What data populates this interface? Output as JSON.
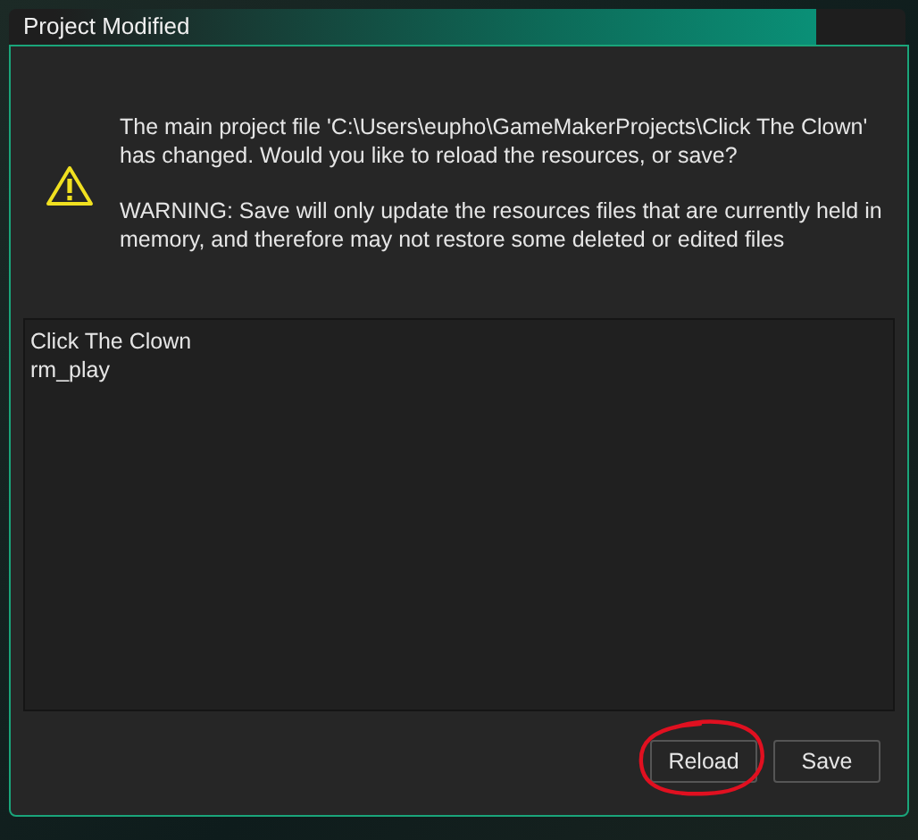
{
  "window": {
    "title": "Project Modified"
  },
  "message": {
    "paragraphs": [
      "The main project file 'C:\\Users\\eupho\\GameMakerProjects\\Click The Clown' has changed. Would you like to reload the resources, or save?",
      "WARNING: Save will only update the resources files that are currently held in memory, and therefore may not restore some deleted or edited files"
    ]
  },
  "list": {
    "items": [
      "Click The Clown",
      "rm_play"
    ]
  },
  "buttons": [
    {
      "label": "Reload",
      "circled": true
    },
    {
      "label": "Save",
      "circled": false
    }
  ]
}
